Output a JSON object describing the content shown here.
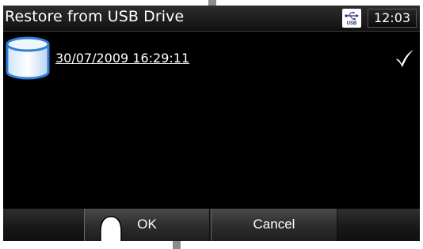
{
  "titlebar": {
    "title": "Restore from USB Drive",
    "usb_badge_text": "USB",
    "clock": "12:03"
  },
  "backup_list": {
    "items": [
      {
        "label": "30/07/2009 16:29:11",
        "selected": true,
        "icon": "database-icon"
      }
    ]
  },
  "buttons": {
    "ok_label": "OK",
    "cancel_label": "Cancel"
  },
  "colors": {
    "screen_background": "#000000",
    "text": "#ffffff",
    "icon_blue": "#2e7fd6"
  }
}
